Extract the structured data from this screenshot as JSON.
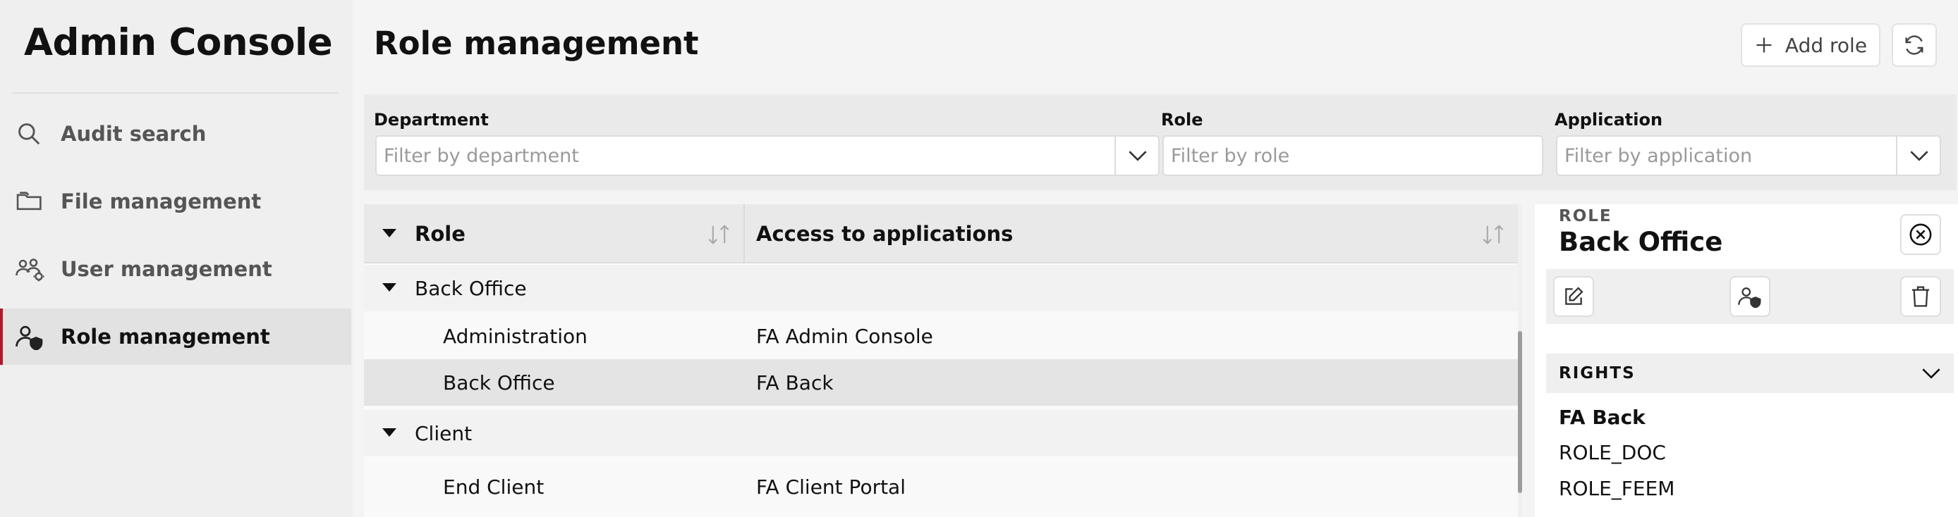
{
  "sidebar": {
    "app_title": "Admin Console",
    "items": [
      {
        "label": "Audit search",
        "icon": "search-icon"
      },
      {
        "label": "File management",
        "icon": "folder-icon"
      },
      {
        "label": "User management",
        "icon": "users-icon"
      },
      {
        "label": "Role management",
        "icon": "user-shield-icon",
        "active": true
      }
    ]
  },
  "header": {
    "title": "Role management",
    "add_label": "Add role"
  },
  "filters": {
    "department": {
      "label": "Department",
      "placeholder": "Filter by department"
    },
    "role": {
      "label": "Role",
      "placeholder": "Filter by role"
    },
    "application": {
      "label": "Application",
      "placeholder": "Filter by application"
    }
  },
  "table": {
    "columns": [
      "Role",
      "Access to applications"
    ],
    "groups": [
      {
        "name": "Back Office",
        "rows": [
          {
            "role": "Administration",
            "access": "FA Admin Console"
          },
          {
            "role": "Back Office",
            "access": "FA Back",
            "selected": true
          }
        ]
      },
      {
        "name": "Client",
        "rows": [
          {
            "role": "End Client",
            "access": "FA Client Portal"
          }
        ]
      }
    ]
  },
  "panel": {
    "kicker": "ROLE",
    "title": "Back Office",
    "rights_label": "RIGHTS",
    "rights_app": "FA Back",
    "rights": [
      "ROLE_DOC",
      "ROLE_FEEM"
    ]
  },
  "colors": {
    "accent": "#b0182a",
    "sidebar_bg": "#efefef",
    "active_bg": "#e2e2e2"
  }
}
